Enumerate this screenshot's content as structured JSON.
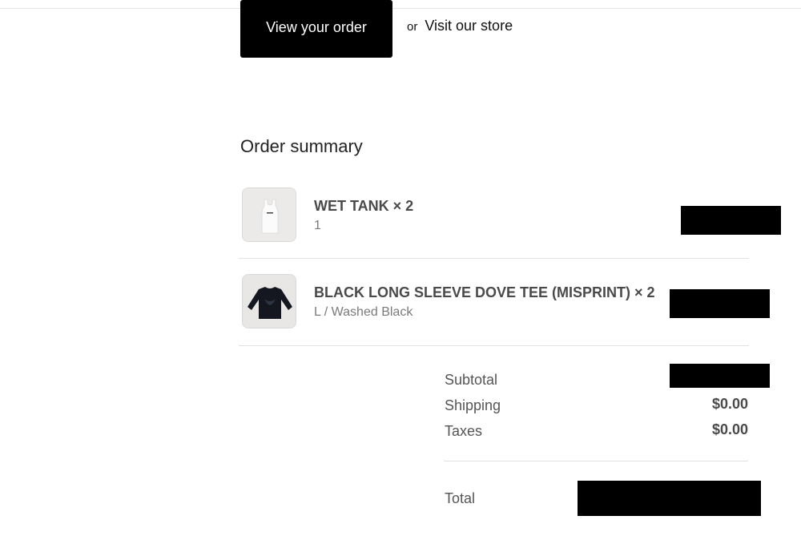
{
  "actions": {
    "view_order_label": "View your order",
    "or_text": "or",
    "visit_store_label": "Visit our store"
  },
  "order_summary": {
    "title": "Order summary",
    "items": [
      {
        "name": "WET TANK × 2",
        "variant": "1",
        "image": "white-tank-top",
        "price": "[redacted]"
      },
      {
        "name": "BLACK LONG SLEEVE DOVE TEE (MISPRINT) × 2",
        "variant": "L / Washed Black",
        "image": "black-long-sleeve-tee",
        "price": "[redacted]"
      }
    ]
  },
  "totals": {
    "subtotal_label": "Subtotal",
    "subtotal_value": "[redacted]",
    "shipping_label": "Shipping",
    "shipping_value": "$0.00",
    "taxes_label": "Taxes",
    "taxes_value": "$0.00",
    "total_label": "Total",
    "total_value": "[redacted]"
  },
  "colors": {
    "button_bg": "#000000",
    "redaction": "#000000",
    "text": "#4a4a4a"
  }
}
